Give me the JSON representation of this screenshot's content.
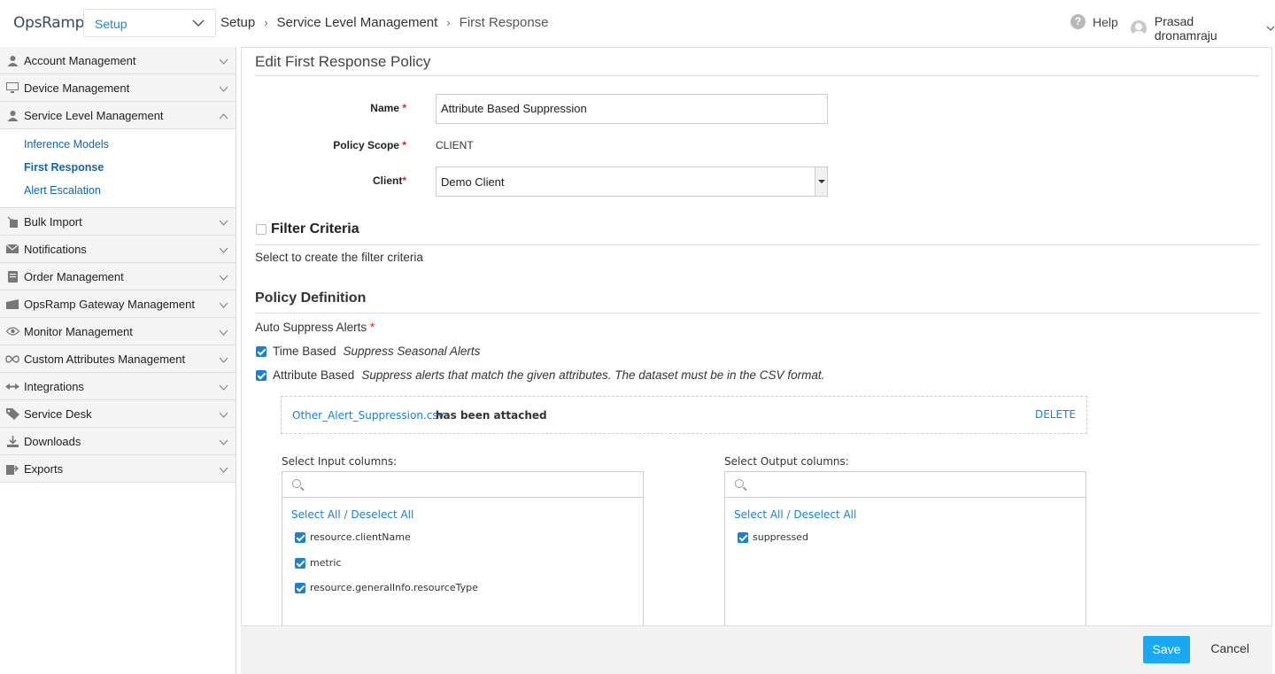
{
  "header": {
    "logo": "OpsRamp",
    "module_select": "Setup",
    "breadcrumb": [
      "Setup",
      "Service Level Management",
      "First Response"
    ],
    "help_label": "Help",
    "user_name": "Prasad dronamraju"
  },
  "sidebar": {
    "sections": [
      {
        "label": "Account Management",
        "icon": "user-icon"
      },
      {
        "label": "Device Management",
        "icon": "monitor-icon"
      },
      {
        "label": "Service Level Management",
        "icon": "user-icon",
        "expanded": true
      }
    ],
    "sub_items": [
      {
        "label": "Inference Models",
        "active": false
      },
      {
        "label": "First Response",
        "active": true
      },
      {
        "label": "Alert Escalation",
        "active": false
      }
    ],
    "more_sections": [
      {
        "label": "Bulk Import",
        "icon": "import-icon"
      },
      {
        "label": "Notifications",
        "icon": "envelope-icon"
      },
      {
        "label": "Order Management",
        "icon": "document-icon"
      },
      {
        "label": "OpsRamp Gateway Management",
        "icon": "gateway-icon"
      },
      {
        "label": "Monitor Management",
        "icon": "eye-icon"
      },
      {
        "label": "Custom Attributes Management",
        "icon": "infinity-icon"
      },
      {
        "label": "Integrations",
        "icon": "integrations-icon"
      },
      {
        "label": "Service Desk",
        "icon": "tag-icon"
      },
      {
        "label": "Downloads",
        "icon": "download-icon"
      },
      {
        "label": "Exports",
        "icon": "export-icon"
      }
    ]
  },
  "form": {
    "title": "Edit First Response Policy",
    "name_label": "Name",
    "name_value": "Attribute Based Suppression",
    "scope_label": "Policy Scope",
    "scope_value": "CLIENT",
    "client_label": "Client",
    "client_value": "Demo Client",
    "required_mark": "*"
  },
  "filter": {
    "label": "Filter Criteria",
    "checked": false,
    "hint": "Select to create the filter criteria"
  },
  "policy": {
    "title": "Policy Definition",
    "auto_suppress_label": "Auto Suppress Alerts",
    "time_based_label": "Time Based",
    "time_based_desc": "Suppress Seasonal Alerts",
    "attr_based_label": "Attribute Based",
    "attr_based_desc": "Suppress alerts that match the given attributes. The dataset must be in the CSV format.",
    "attachment": {
      "file_name": "Other_Alert_Suppression.csv",
      "message": "has been attached",
      "delete_label": "DELETE"
    },
    "input_columns": {
      "title": "Select Input columns:",
      "select_all": "Select All / Deselect All",
      "options": [
        "resource.clientName",
        "metric",
        "resource.generalInfo.resourceType"
      ]
    },
    "output_columns": {
      "title": "Select Output columns:",
      "select_all": "Select All / Deselect All",
      "options": [
        "suppressed"
      ]
    }
  },
  "footer": {
    "save_label": "Save",
    "cancel_label": "Cancel"
  },
  "colors": {
    "accent": "#1a7fd6",
    "save_button": "#19a9f2",
    "required": "#d9251d"
  }
}
